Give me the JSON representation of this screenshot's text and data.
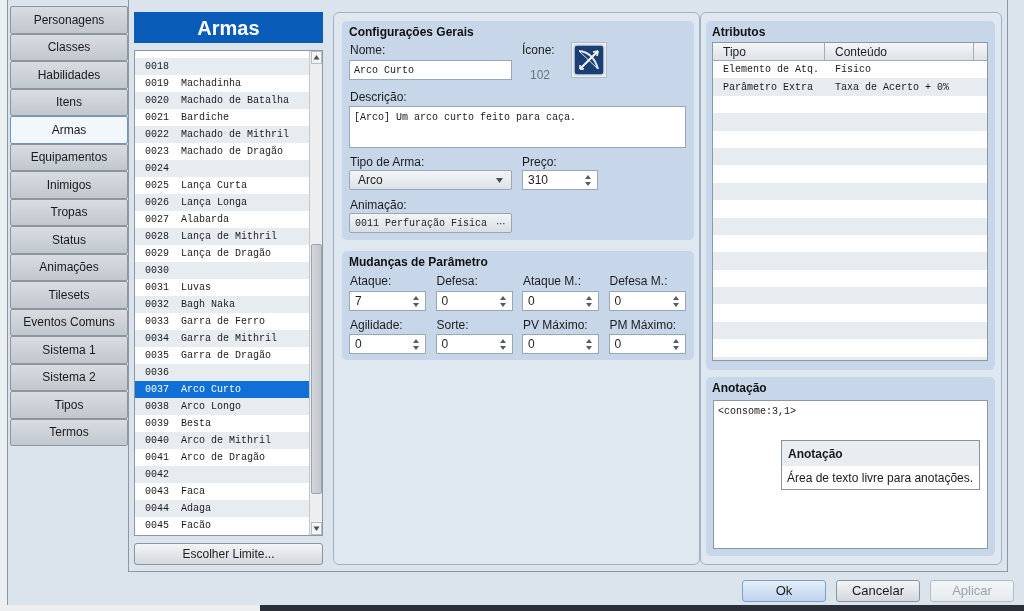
{
  "nav": [
    {
      "label": "Personagens",
      "selected": false
    },
    {
      "label": "Classes",
      "selected": false
    },
    {
      "label": "Habilidades",
      "selected": false
    },
    {
      "label": "Itens",
      "selected": false
    },
    {
      "label": "Armas",
      "selected": true
    },
    {
      "label": "Equipamentos",
      "selected": false
    },
    {
      "label": "Inimigos",
      "selected": false
    },
    {
      "label": "Tropas",
      "selected": false
    },
    {
      "label": "Status",
      "selected": false
    },
    {
      "label": "Animações",
      "selected": false
    },
    {
      "label": "Tilesets",
      "selected": false
    },
    {
      "label": "Eventos Comuns",
      "selected": false
    },
    {
      "label": "Sistema 1",
      "selected": false
    },
    {
      "label": "Sistema 2",
      "selected": false
    },
    {
      "label": "Tipos",
      "selected": false
    },
    {
      "label": "Termos",
      "selected": false
    }
  ],
  "list": {
    "title": "Armas",
    "items": [
      {
        "id": "0018",
        "selected": false
      },
      {
        "id": "0019",
        "name": "Machadinha",
        "selected": false
      },
      {
        "id": "0020",
        "name": "Machado de Batalha",
        "selected": false
      },
      {
        "id": "0021",
        "name": "Bardiche",
        "selected": false
      },
      {
        "id": "0022",
        "name": "Machado de Mithril",
        "selected": false
      },
      {
        "id": "0023",
        "name": "Machado de Dragão",
        "selected": false
      },
      {
        "id": "0024",
        "selected": false
      },
      {
        "id": "0025",
        "name": "Lança Curta",
        "selected": false
      },
      {
        "id": "0026",
        "name": "Lança Longa",
        "selected": false
      },
      {
        "id": "0027",
        "name": "Alabarda",
        "selected": false
      },
      {
        "id": "0028",
        "name": "Lança de Mithril",
        "selected": false
      },
      {
        "id": "0029",
        "name": "Lança de Dragão",
        "selected": false
      },
      {
        "id": "0030",
        "selected": false
      },
      {
        "id": "0031",
        "name": "Luvas",
        "selected": false
      },
      {
        "id": "0032",
        "name": "Bagh Naka",
        "selected": false
      },
      {
        "id": "0033",
        "name": "Garra de Ferro",
        "selected": false
      },
      {
        "id": "0034",
        "name": "Garra de Mithril",
        "selected": false
      },
      {
        "id": "0035",
        "name": "Garra de Dragão",
        "selected": false
      },
      {
        "id": "0036",
        "selected": false
      },
      {
        "id": "0037",
        "name": "Arco Curto",
        "selected": true
      },
      {
        "id": "0038",
        "name": "Arco Longo",
        "selected": false
      },
      {
        "id": "0039",
        "name": "Besta",
        "selected": false
      },
      {
        "id": "0040",
        "name": "Arco de Mithril",
        "selected": false
      },
      {
        "id": "0041",
        "name": "Arco de Dragão",
        "selected": false
      },
      {
        "id": "0042",
        "selected": false
      },
      {
        "id": "0043",
        "name": "Faca",
        "selected": false
      },
      {
        "id": "0044",
        "name": "Adaga",
        "selected": false
      },
      {
        "id": "0045",
        "name": "Facão",
        "selected": false
      }
    ],
    "button": "Escolher Limite..."
  },
  "general": {
    "title": "Configurações Gerais",
    "name_label": "Nome:",
    "name_value": "Arco Curto",
    "icon_label": "Ícone:",
    "icon_index": "102",
    "description_label": "Descrição:",
    "description_value": "[Arco] Um arco curto feito para caça.",
    "weapon_type_label": "Tipo de Arma:",
    "weapon_type_value": "Arco",
    "price_label": "Preço:",
    "price_value": "310",
    "animation_label": "Animação:",
    "animation_value": "0011 Perfuração Física",
    "animation_more": "⋯"
  },
  "params": {
    "title": "Mudanças de Parâmetro",
    "fields": [
      {
        "label": "Ataque:",
        "value": "7"
      },
      {
        "label": "Defesa:",
        "value": "0"
      },
      {
        "label": "Ataque M.:",
        "value": "0"
      },
      {
        "label": "Defesa M.:",
        "value": "0"
      },
      {
        "label": "Agilidade:",
        "value": "0"
      },
      {
        "label": "Sorte:",
        "value": "0"
      },
      {
        "label": "PV Máximo:",
        "value": "0"
      },
      {
        "label": "PM Máximo:",
        "value": "0"
      }
    ]
  },
  "traits": {
    "title": "Atributos",
    "columns": [
      "Tipo",
      "Conteúdo"
    ],
    "rows": [
      {
        "cells": [
          "Elemento de Atq.",
          "Físico"
        ]
      },
      {
        "cells": [
          "Parâmetro Extra",
          "Taxa de Acerto + 0%"
        ]
      }
    ]
  },
  "note": {
    "title": "Anotação",
    "value": "<consome:3,1>",
    "tooltip": {
      "title": "Anotação",
      "text": "Área de texto livre para anotações."
    }
  },
  "buttons": [
    {
      "label": "Ok",
      "default": true,
      "disabled": false
    },
    {
      "label": "Cancelar",
      "default": false,
      "disabled": false
    },
    {
      "label": "Aplicar",
      "default": false,
      "disabled": true
    }
  ]
}
